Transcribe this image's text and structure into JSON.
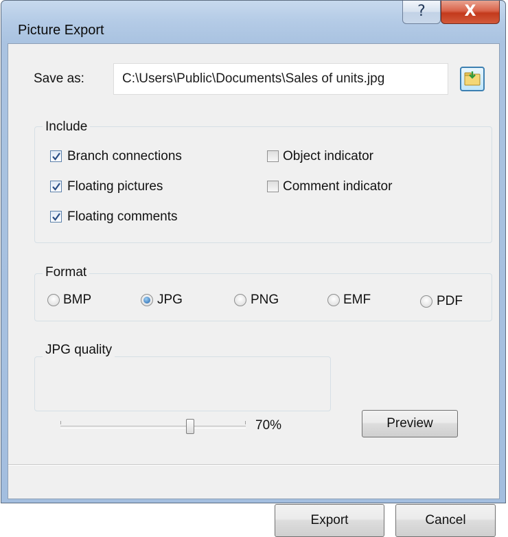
{
  "window": {
    "title": "Picture Export",
    "help_label": "?",
    "close_label": "X"
  },
  "save_as": {
    "label": "Save as:",
    "path": "C:\\Users\\Public\\Documents\\Sales of units.jpg"
  },
  "include": {
    "title": "Include",
    "options": [
      {
        "label": "Branch connections",
        "checked": true
      },
      {
        "label": "Floating pictures",
        "checked": true
      },
      {
        "label": "Floating comments",
        "checked": true
      },
      {
        "label": "Object indicator",
        "checked": false
      },
      {
        "label": "Comment indicator",
        "checked": false
      }
    ]
  },
  "format": {
    "title": "Format",
    "options": [
      {
        "label": "BMP",
        "selected": false
      },
      {
        "label": "JPG",
        "selected": true
      },
      {
        "label": "PNG",
        "selected": false
      },
      {
        "label": "EMF",
        "selected": false
      },
      {
        "label": "PDF",
        "selected": false
      }
    ]
  },
  "quality": {
    "title": "JPG quality",
    "value": 70,
    "value_label": "70%",
    "preview_label": "Preview"
  },
  "buttons": {
    "export_label": "Export",
    "cancel_label": "Cancel"
  },
  "colors": {
    "title_bar": "#aec6e2",
    "close_button": "#c94a2c",
    "dialog_body": "#f0f0f0"
  }
}
